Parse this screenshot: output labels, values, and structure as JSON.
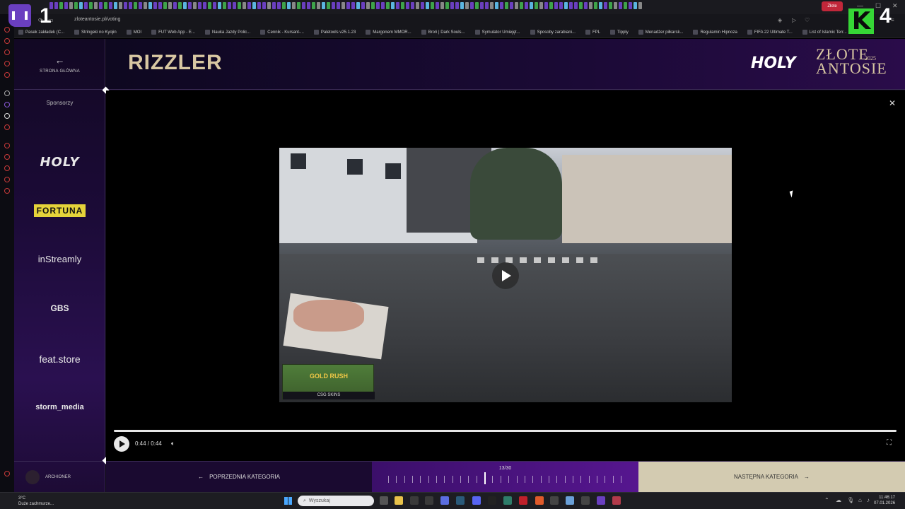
{
  "overlay": {
    "left_number": "1",
    "right_number": "4",
    "k_letter": "K"
  },
  "browser": {
    "url": "zloteantosie.pl/voting",
    "active_tab_label": "Złote",
    "bookmarks": [
      "Pasek zakładek (C...",
      "Stringeki no Kyojin",
      "MOI",
      "FUT Web App - E...",
      "Nauka Jazdy Polic...",
      "Cennik - Kursant-...",
      "Paletools v25.1.23",
      "Margonem MMOR...",
      "Broń | Dark Souls...",
      "Symulator Umiejęt...",
      "Sposoby zarabiani...",
      "FPL",
      "Tipply",
      "Menadżer piłkarsk...",
      "Regulamin Hipnoza",
      "FIFA 22 Ultimate T...",
      "List of Islamic Terr..."
    ]
  },
  "sidebar": {
    "home_label": "STRONA GŁÓWNA",
    "sponsors_label": "Sponsorzy",
    "sponsors": [
      "HOLY",
      "FORTUNA",
      "inStreamly",
      "GBS",
      "feat.store",
      "storm_media"
    ],
    "user_label": "ARCHIONER"
  },
  "header": {
    "title": "RIZZLER",
    "brand_holy": "HOLY",
    "brand_line1": "ZŁOTE",
    "brand_line2": "ANTOSIE",
    "brand_year": "2025"
  },
  "video": {
    "ad_title": "GOLD RUSH",
    "ad_sub": "CSG SKINS",
    "time": "0:44 / 0:44",
    "progress": 1.0
  },
  "footer": {
    "prev_label": "POPRZEDNIA KATEGORIA",
    "counter": "13/30",
    "next_label": "NASTĘPNA KATEGORIA",
    "current": 13,
    "total": 30
  },
  "taskbar": {
    "weather_temp": "3°C",
    "weather_desc": "Duże zachmurze...",
    "search_placeholder": "Wyszukaj",
    "time": "11:46:17",
    "date": "07.01.2026"
  },
  "colors": {
    "accent_gold": "#d8c7a2",
    "purple": "#56168f",
    "twitch": "#6a3fc0",
    "k_green": "#36d636"
  }
}
